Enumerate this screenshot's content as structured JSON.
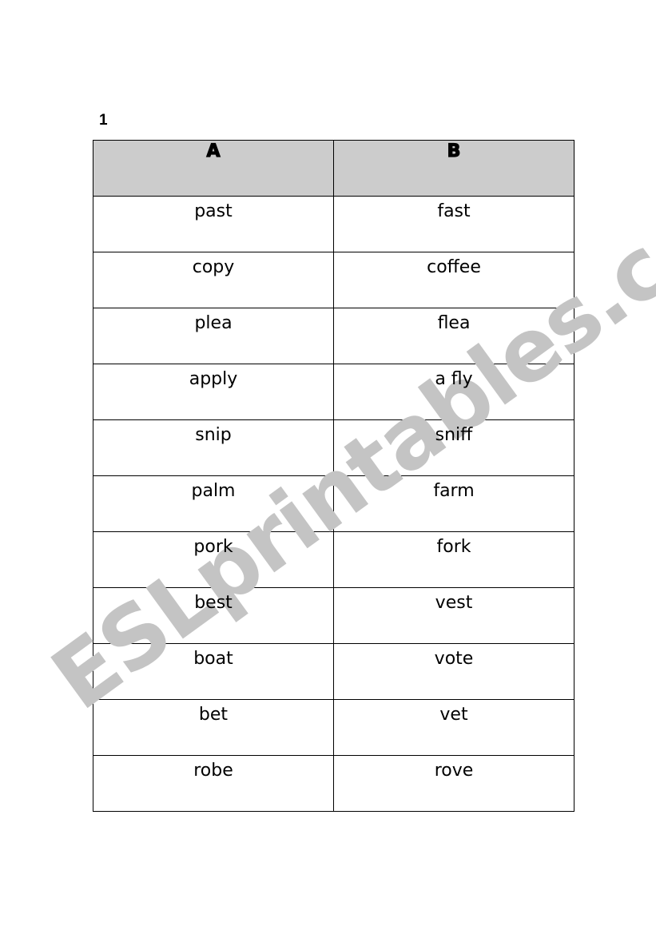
{
  "exercise_number": "1",
  "watermark": "ESLprintables.com",
  "table": {
    "headers": [
      "A",
      "B"
    ],
    "rows": [
      [
        "past",
        "fast"
      ],
      [
        "copy",
        "coffee"
      ],
      [
        "plea",
        "flea"
      ],
      [
        "apply",
        "a fly"
      ],
      [
        "snip",
        "sniff"
      ],
      [
        "palm",
        "farm"
      ],
      [
        "pork",
        "fork"
      ],
      [
        "best",
        "vest"
      ],
      [
        "boat",
        "vote"
      ],
      [
        "bet",
        "vet"
      ],
      [
        "robe",
        "rove"
      ]
    ]
  },
  "colors": {
    "header_bg": "#cccccc",
    "watermark": "#c4c4c4"
  }
}
